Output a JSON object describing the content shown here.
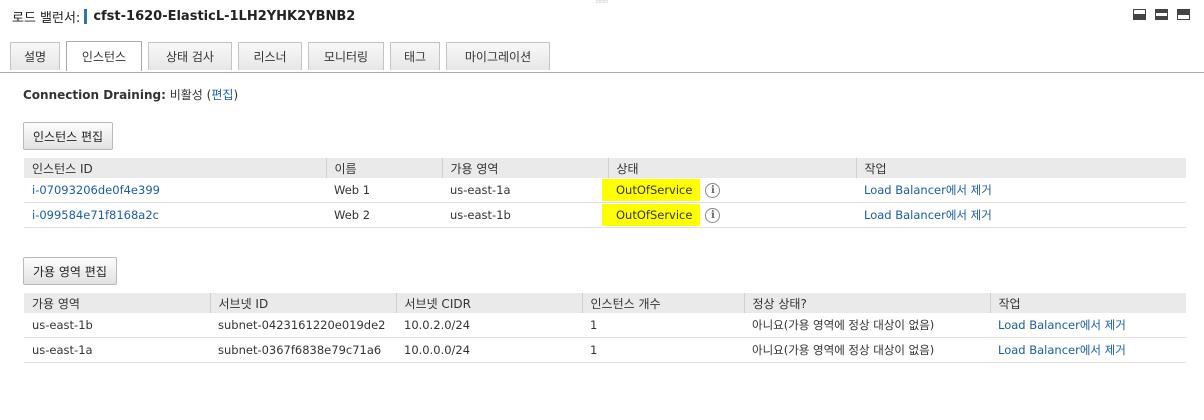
{
  "header": {
    "label": "로드 밸런서:",
    "lb_name": "cfst-1620-ElasticL-1LH2YHK2YBNB2"
  },
  "tabs": [
    {
      "label": "설명"
    },
    {
      "label": "인스턴스"
    },
    {
      "label": "상태 검사"
    },
    {
      "label": "리스너"
    },
    {
      "label": "모니터링"
    },
    {
      "label": "태그"
    },
    {
      "label": "마이그레이션"
    }
  ],
  "active_tab": "인스턴스",
  "connection_draining": {
    "label": "Connection Draining:",
    "value": "비활성",
    "edit_paren_open": "(",
    "edit_link": "편집",
    "edit_paren_close": ")"
  },
  "instances": {
    "edit_button": "인스턴스 편집",
    "columns": [
      "인스턴스 ID",
      "이름",
      "가용 영역",
      "상태",
      "작업"
    ],
    "rows": [
      {
        "id": "i-07093206de0f4e399",
        "name": "Web 1",
        "az": "us-east-1a",
        "status": "OutOfService",
        "action": "Load Balancer에서 제거"
      },
      {
        "id": "i-099584e71f8168a2c",
        "name": "Web 2",
        "az": "us-east-1b",
        "status": "OutOfService",
        "action": "Load Balancer에서 제거"
      }
    ]
  },
  "zones": {
    "edit_button": "가용 영역 편집",
    "columns": [
      "가용 영역",
      "서브넷 ID",
      "서브넷 CIDR",
      "인스턴스 개수",
      "정상 상태?",
      "작업"
    ],
    "rows": [
      {
        "az": "us-east-1b",
        "subnet": "subnet-0423161220e019de2",
        "cidr": "10.0.2.0/24",
        "count": "1",
        "healthy": "아니요(가용 영역에 정상 대상이 없음)",
        "action": "Load Balancer에서 제거"
      },
      {
        "az": "us-east-1a",
        "subnet": "subnet-0367f6838e79c71a6",
        "cidr": "10.0.0.0/24",
        "count": "1",
        "healthy": "아니요(가용 영역에 정상 대상이 없음)",
        "action": "Load Balancer에서 제거"
      }
    ]
  },
  "icons": {
    "info": "info-icon",
    "window_buttons": [
      "panel-bottom-icon",
      "panel-split-icon",
      "panel-top-icon"
    ]
  },
  "colors": {
    "link": "#1a5ca8",
    "highlight": "#ffff00",
    "accent": "#2e73b8"
  }
}
